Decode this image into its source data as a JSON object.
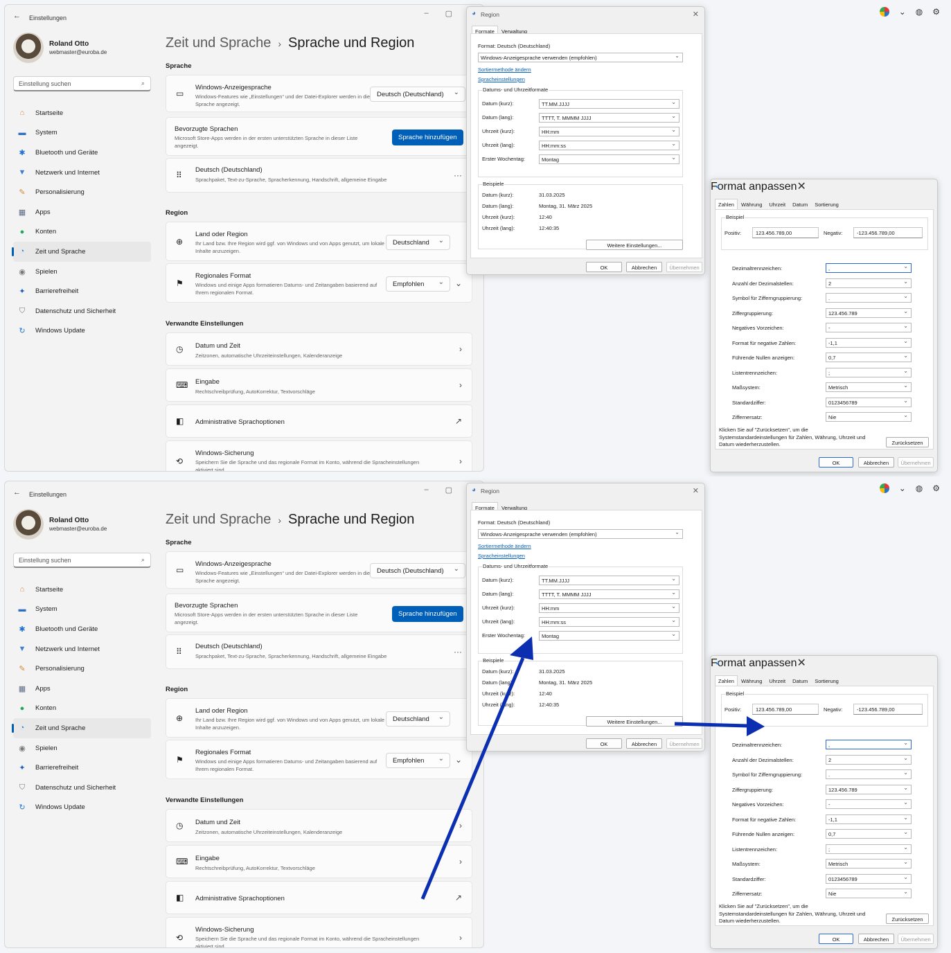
{
  "desktop": {
    "icons": [
      "copilot-icon",
      "chevron-down-icon",
      "globe-icon",
      "gear-icon"
    ]
  },
  "settings": {
    "window_title": "Einstellungen",
    "user_name": "Roland Otto",
    "user_email": "webmaster@euroba.de",
    "search_placeholder": "Einstellung suchen",
    "nav": [
      {
        "label": "Startseite",
        "icon": "home-icon"
      },
      {
        "label": "System",
        "icon": "monitor-icon"
      },
      {
        "label": "Bluetooth und Geräte",
        "icon": "bluetooth-icon"
      },
      {
        "label": "Netzwerk und Internet",
        "icon": "wifi-icon"
      },
      {
        "label": "Personalisierung",
        "icon": "brush-icon"
      },
      {
        "label": "Apps",
        "icon": "apps-icon"
      },
      {
        "label": "Konten",
        "icon": "person-icon"
      },
      {
        "label": "Zeit und Sprache",
        "icon": "clock-globe-icon"
      },
      {
        "label": "Spielen",
        "icon": "gamepad-icon"
      },
      {
        "label": "Barrierefreiheit",
        "icon": "accessibility-icon"
      },
      {
        "label": "Datenschutz und Sicherheit",
        "icon": "shield-icon"
      },
      {
        "label": "Windows Update",
        "icon": "update-icon"
      }
    ],
    "breadcrumb_parent": "Zeit und Sprache",
    "breadcrumb_sep": "›",
    "breadcrumb_current": "Sprache und Region",
    "section_language": "Sprache",
    "display_language": {
      "title": "Windows-Anzeigesprache",
      "desc": "Windows-Features wie „Einstellungen“ und der Datei-Explorer werden in dieser Sprache angezeigt.",
      "value": "Deutsch (Deutschland)"
    },
    "preferred": {
      "title": "Bevorzugte Sprachen",
      "desc": "Microsoft Store-Apps werden in der ersten unterstützten Sprache in dieser Liste angezeigt.",
      "button": "Sprache hinzufügen"
    },
    "german": {
      "title": "Deutsch (Deutschland)",
      "desc": "Sprachpaket, Text-zu-Sprache, Spracherkennung, Handschrift, allgemeine Eingabe",
      "more": "···"
    },
    "section_region": "Region",
    "country": {
      "title": "Land oder Region",
      "desc": "Ihr Land bzw. Ihre Region wird ggf. von Windows und von Apps genutzt, um lokale Inhalte anzuzeigen.",
      "value": "Deutschland"
    },
    "regional_format": {
      "title": "Regionales Format",
      "desc": "Windows und einige Apps formatieren Datums- und Zeitangaben basierend auf Ihrem regionalen Format.",
      "value": "Empfohlen"
    },
    "section_related": "Verwandte Einstellungen",
    "date_time": {
      "title": "Datum und Zeit",
      "desc": "Zeitzonen, automatische Uhrzeiteinstellungen, Kalenderanzeige"
    },
    "input": {
      "title": "Eingabe",
      "desc": "Rechtschreibprüfung, AutoKorrektur, Textvorschläge"
    },
    "admin": {
      "title": "Administrative Sprachoptionen"
    },
    "backup": {
      "title": "Windows-Sicherung",
      "desc": "Speichern Sie die Sprache und das regionale Format im Konto, während die Spracheinstellungen aktiviert sind."
    }
  },
  "region_dialog": {
    "title": "Region",
    "tabs": [
      "Formate",
      "Verwaltung"
    ],
    "format_label": "Format: Deutsch (Deutschland)",
    "format_value": "Windows-Anzeigesprache verwenden (empfohlen)",
    "link_sort": "Sortiermethode ändern",
    "link_lang": "Spracheinstellungen",
    "group_title": "Datums- und Uhrzeitformate",
    "rows": [
      {
        "label": "Datum (kurz):",
        "value": "TT.MM.JJJJ"
      },
      {
        "label": "Datum (lang):",
        "value": "TTTT, T. MMMM JJJJ"
      },
      {
        "label": "Uhrzeit (kurz):",
        "value": "HH:mm"
      },
      {
        "label": "Uhrzeit (lang):",
        "value": "HH:mm:ss"
      },
      {
        "label": "Erster Wochentag:",
        "value": "Montag"
      }
    ],
    "examples_title": "Beispiele",
    "examples": [
      {
        "label": "Datum (kurz):",
        "value": "31.03.2025"
      },
      {
        "label": "Datum (lang):",
        "value": "Montag, 31. März 2025"
      },
      {
        "label": "Uhrzeit (kurz):",
        "value": "12:40"
      },
      {
        "label": "Uhrzeit (lang):",
        "value": "12:40:35"
      }
    ],
    "more_button": "Weitere Einstellungen...",
    "ok": "OK",
    "cancel": "Abbrechen",
    "apply": "Übernehmen"
  },
  "format_dialog": {
    "title": "Format anpassen",
    "tabs": [
      "Zahlen",
      "Währung",
      "Uhrzeit",
      "Datum",
      "Sortierung"
    ],
    "example_title": "Beispiel",
    "positive_label": "Positiv:",
    "positive_value": "123.456.789,00",
    "negative_label": "Negativ:",
    "negative_value": "-123.456.789,00",
    "rows": [
      {
        "label": "Dezimaltrennzeichen:",
        "value": ","
      },
      {
        "label": "Anzahl der Dezimalstellen:",
        "value": "2"
      },
      {
        "label": "Symbol für Zifferngruppierung:",
        "value": "."
      },
      {
        "label": "Ziffergruppierung:",
        "value": "123.456.789"
      },
      {
        "label": "Negatives Vorzeichen:",
        "value": "-"
      },
      {
        "label": "Format für negative Zahlen:",
        "value": "-1,1"
      },
      {
        "label": "Führende Nullen anzeigen:",
        "value": "0,7"
      },
      {
        "label": "Listentrennzeichen:",
        "value": ";"
      },
      {
        "label": "Maßsystem:",
        "value": "Metrisch"
      },
      {
        "label": "Standardziffer:",
        "value": "0123456789"
      },
      {
        "label": "Ziffernersatz:",
        "value": "Nie"
      }
    ],
    "reset_text": "Klicken Sie auf \"Zurücksetzen\", um die Systemstandardeinstellungen für Zahlen, Währung, Uhrzeit und Datum wiederherzustellen.",
    "reset_button": "Zurücksetzen",
    "ok": "OK",
    "cancel": "Abbrechen",
    "apply": "Übernehmen"
  },
  "colors": {
    "accent": "#005fb8",
    "arrow": "#0b2fb0"
  }
}
